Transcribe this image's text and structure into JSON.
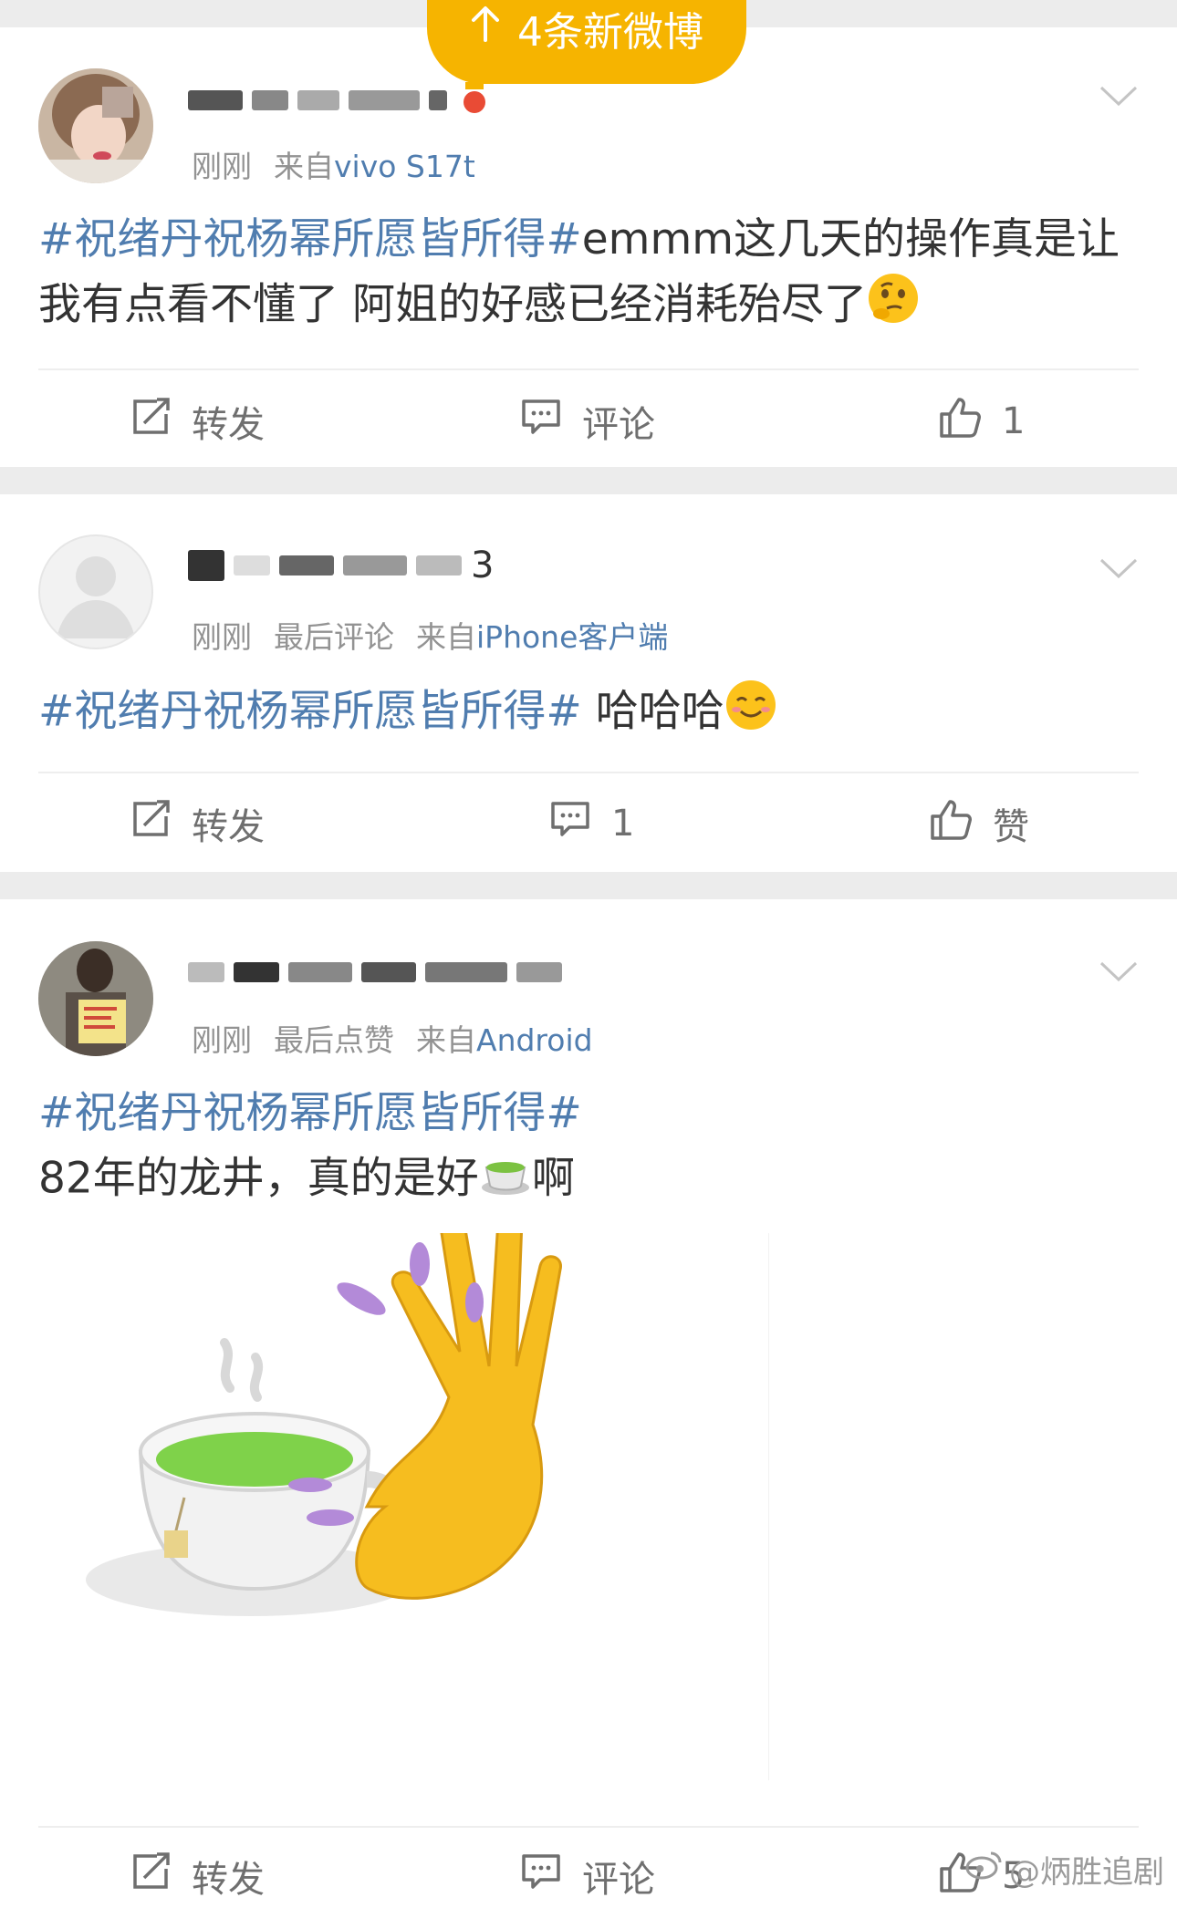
{
  "new_posts_banner": {
    "label": "4条新微博"
  },
  "posts": [
    {
      "meta_time": "刚刚",
      "meta_extra": "",
      "meta_from": "来自",
      "meta_source": "vivo S17t",
      "topic": "#祝绪丹祝杨幂所愿皆所得#",
      "body": "emmm这几天的操作真是让我有点看不懂了 阿姐的好感已经消耗殆尽了",
      "repost_label": "转发",
      "comment_label": "评论",
      "like_label": "1"
    },
    {
      "name_visible": "3",
      "meta_time": "刚刚",
      "meta_extra": "最后评论",
      "meta_from": "来自",
      "meta_source": "iPhone客户端",
      "topic": "#祝绪丹祝杨幂所愿皆所得#",
      "body": " 哈哈哈",
      "repost_label": "转发",
      "comment_label": "1",
      "like_label": "赞"
    },
    {
      "meta_time": "刚刚",
      "meta_extra": "最后点赞",
      "meta_from": "来自",
      "meta_source": "Android",
      "topic": "#祝绪丹祝杨幂所愿皆所得#",
      "body_line1": "82年的龙井，真的是好",
      "body_line2": "啊",
      "repost_label": "转发",
      "comment_label": "评论",
      "like_label": "5"
    }
  ],
  "watermark": "@炳胜追剧",
  "colors": {
    "accent_link": "#507daf",
    "banner": "#f6b400",
    "meta_gray": "#939393"
  }
}
